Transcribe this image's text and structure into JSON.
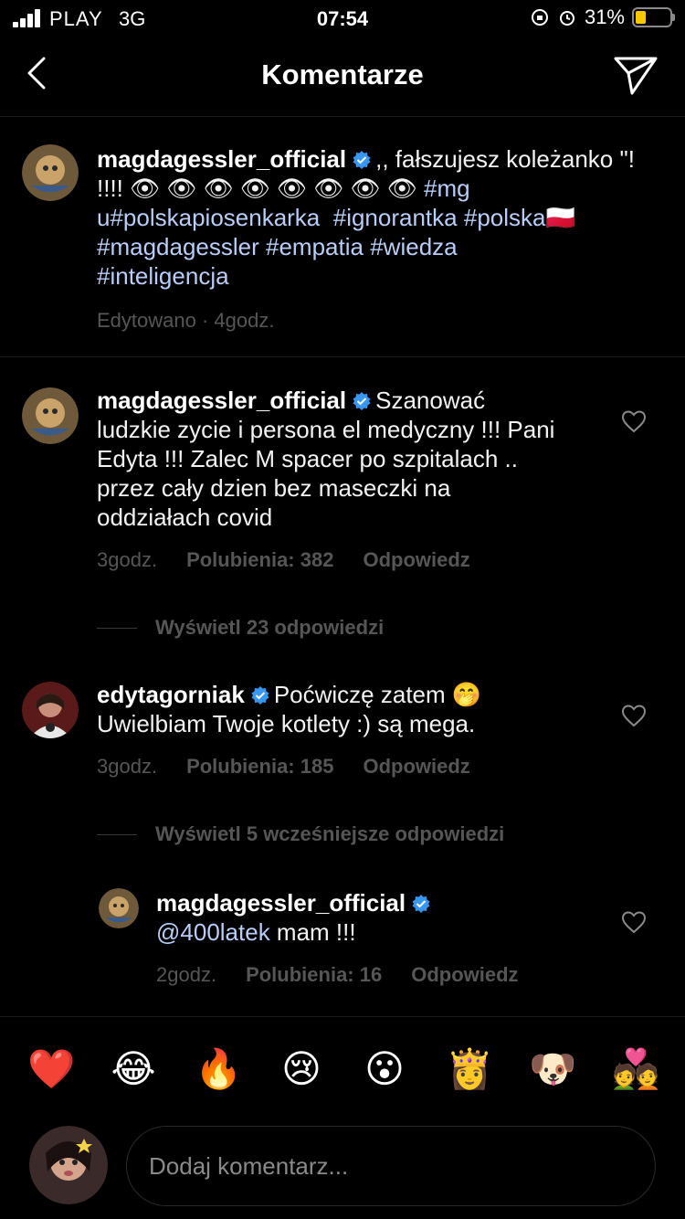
{
  "status_bar": {
    "carrier": "PLAY",
    "network": "3G",
    "time": "07:54",
    "battery": "31%",
    "battery_level": 0.31
  },
  "header": {
    "title": "Komentarze"
  },
  "caption": {
    "username": "magdagessler_official",
    "text_start": ",, fałszujesz koleżanko \"! !!!! 👁 👁 👁 👁 👁 👁 👁 👁 ",
    "tags": [
      "#mg",
      "u#polskapiosenkarka",
      "#ignorantka",
      "#polska",
      "#magdagessler",
      "#empatia",
      "#wiedza",
      "#inteligencja"
    ],
    "flag": "🇵🇱",
    "meta": "Edytowano · 4godz."
  },
  "comments": [
    {
      "username": "magdagessler_official",
      "text": "Szanować ludzkie zycie i persona el medyczny !!! Pani Edyta !!! Zalec M spacer po szpitalach .. przez cały dzien bez maseczki na oddziałach covid",
      "time": "3godz.",
      "likes": "Polubienia: 382",
      "reply": "Odpowiedz",
      "view_replies": "Wyświetl 23 odpowiedzi"
    },
    {
      "username": "edytagorniak",
      "text": "Poćwiczę zatem 🤭 Uwielbiam Twoje kotlety :) są mega.",
      "time": "3godz.",
      "likes": "Polubienia: 185",
      "reply": "Odpowiedz",
      "view_replies": "Wyświetl 5 wcześniejsze odpowiedzi"
    }
  ],
  "reply": {
    "username": "magdagessler_official",
    "mention": "@400latek",
    "text": " mam !!!",
    "time": "2godz.",
    "likes": "Polubienia: 16",
    "reply": "Odpowiedz"
  },
  "emoji_bar": [
    "❤️",
    "😂",
    "🔥",
    "😢",
    "😮",
    "👸",
    "🐶",
    "💑"
  ],
  "input": {
    "placeholder": "Dodaj komentarz..."
  },
  "colors": {
    "background": "#000000",
    "hashtag": "#b9cdf7",
    "muted": "#565656",
    "verified": "#3897f0",
    "battery": "#f6c800"
  }
}
